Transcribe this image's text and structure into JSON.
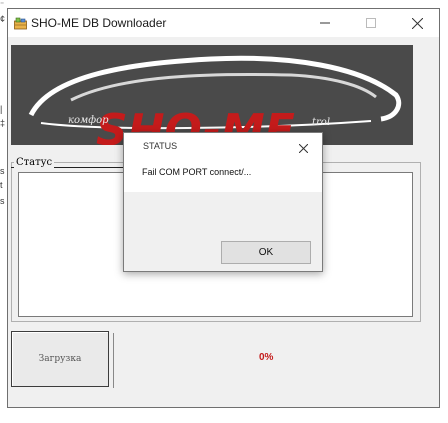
{
  "window": {
    "title": "SHO-ME DB Downloader",
    "icon": "app-icon",
    "controls": [
      "minimize-icon",
      "maximize-icon",
      "close-icon"
    ]
  },
  "banner": {
    "brand_text": "SHO-ME",
    "slogan_left": "комфор",
    "slogan_right": "trol"
  },
  "status_group": {
    "legend": "Статус"
  },
  "actions": {
    "download_label": "Загрузка"
  },
  "progress": {
    "text": "0%",
    "value_percent": 0,
    "color": "#c41b1b"
  },
  "dialog": {
    "title": "STATUS",
    "message": "Fail COM PORT connect/...",
    "ok_label": "OK"
  },
  "colors": {
    "banner_bg": "#4a4a4a",
    "brand_red": "#c41b1b",
    "window_bg": "#f0f0f0"
  }
}
